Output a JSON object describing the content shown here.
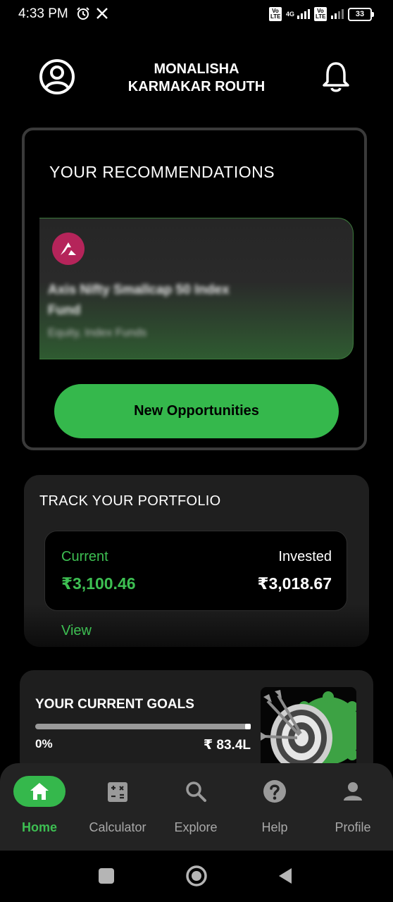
{
  "status_bar": {
    "time": "4:33 PM",
    "network_type": "4G",
    "volte_label": "Vo LTE",
    "battery": "33"
  },
  "header": {
    "user_name_line1": "MONALISHA",
    "user_name_line2": "KARMAKAR ROUTH"
  },
  "recommendations": {
    "title": "YOUR RECOMMENDATIONS",
    "fund_name": "Axis Nifty Smallcap 50 Index Fund",
    "fund_subtitle": "Equity, Index Funds",
    "button_label": "New Opportunities"
  },
  "portfolio": {
    "title": "TRACK YOUR PORTFOLIO",
    "current_label": "Current",
    "current_value": "₹3,100.46",
    "invested_label": "Invested",
    "invested_value": "₹3,018.67",
    "view_label": "View"
  },
  "goals": {
    "title": "YOUR CURRENT GOALS",
    "progress_text": "0%",
    "progress": 0,
    "target_amount": "₹ 83.4L"
  },
  "bottom_nav": {
    "items": [
      {
        "label": "Home",
        "icon": "home-icon",
        "active": true
      },
      {
        "label": "Calculator",
        "icon": "calculator-icon",
        "active": false
      },
      {
        "label": "Explore",
        "icon": "search-icon",
        "active": false
      },
      {
        "label": "Help",
        "icon": "help-icon",
        "active": false
      },
      {
        "label": "Profile",
        "icon": "person-icon",
        "active": false
      }
    ]
  },
  "colors": {
    "accent": "#35b84c",
    "background": "#000000",
    "card": "#1f1f1f"
  }
}
